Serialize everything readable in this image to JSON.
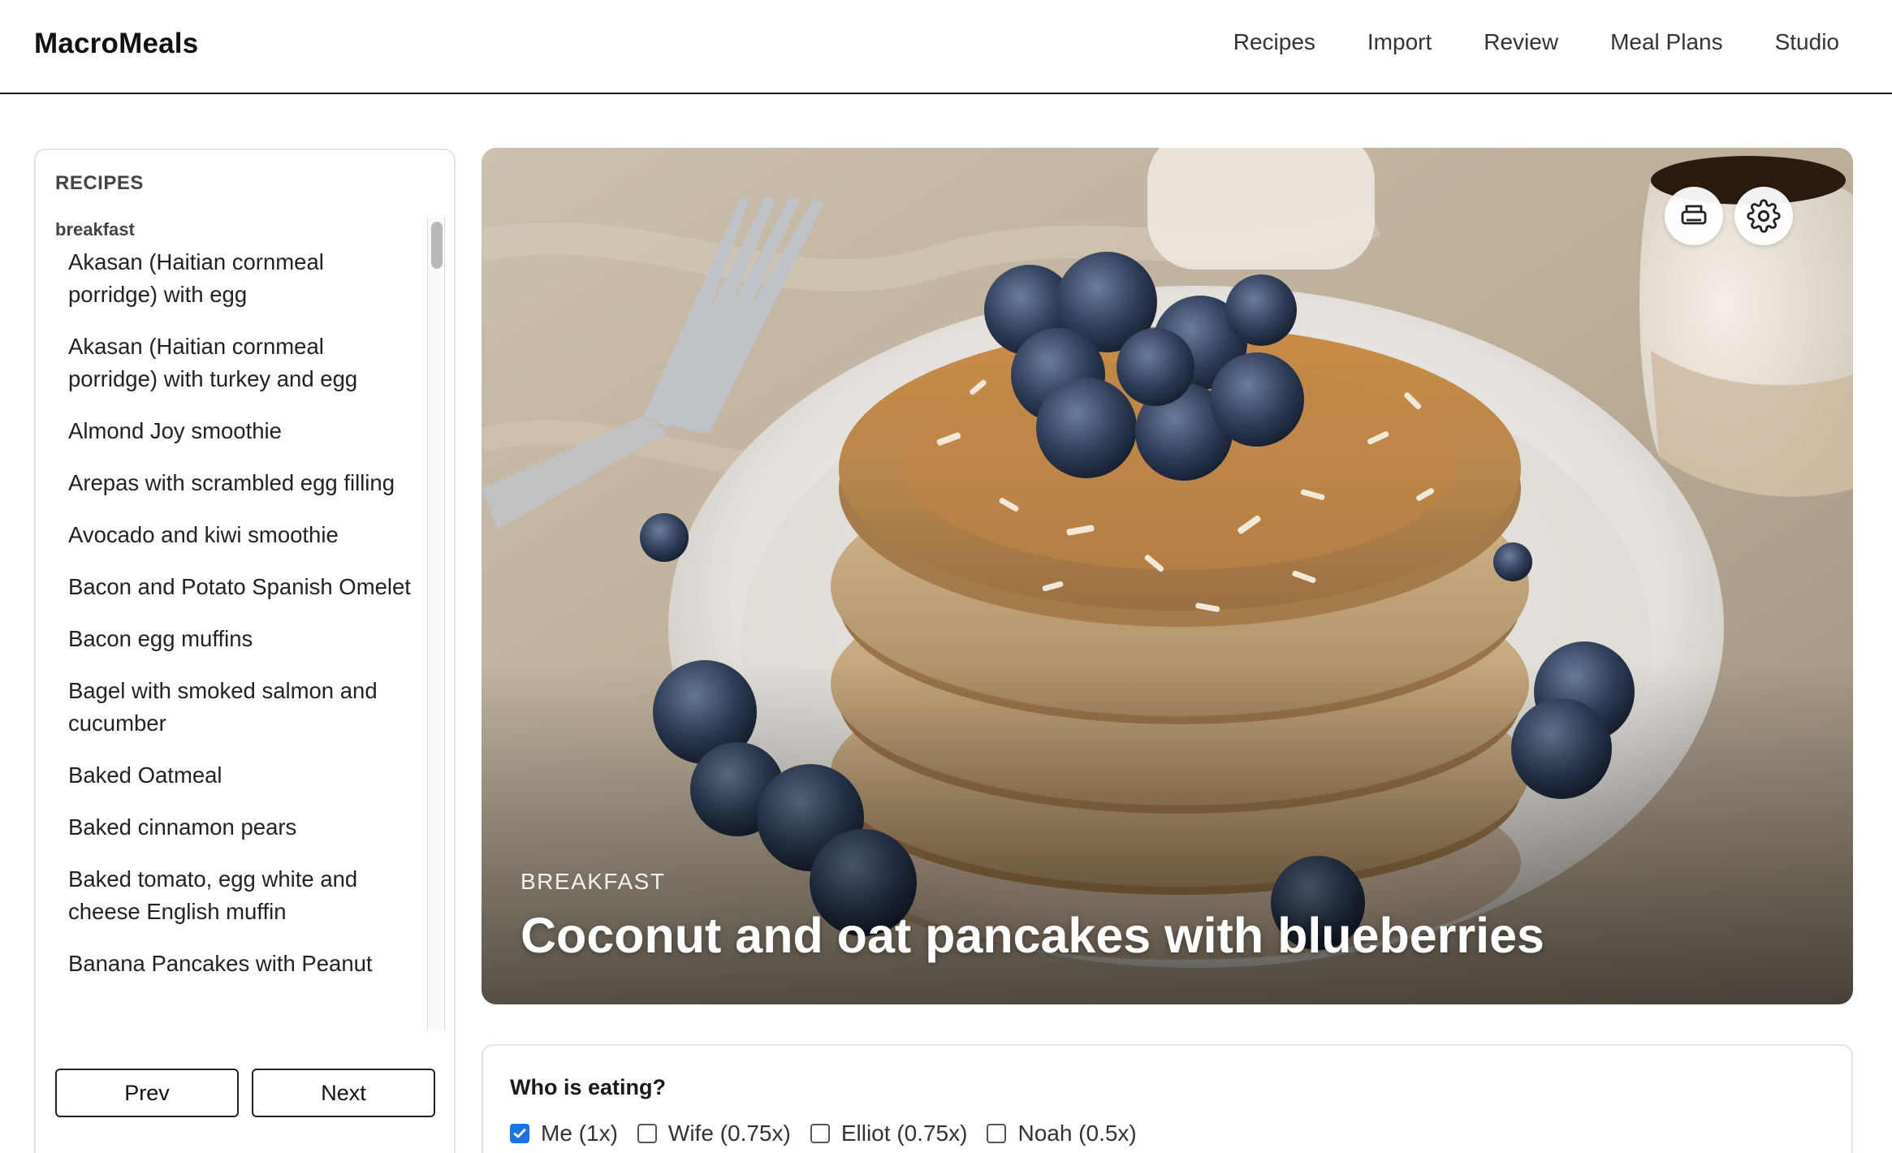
{
  "app": {
    "name": "MacroMeals"
  },
  "nav": {
    "items": [
      "Recipes",
      "Import",
      "Review",
      "Meal Plans",
      "Studio"
    ]
  },
  "sidebar": {
    "heading": "RECIPES",
    "group": "breakfast",
    "items": [
      "Akasan (Haitian cornmeal porridge) with egg",
      "Akasan (Haitian cornmeal porridge) with turkey and egg",
      "Almond Joy smoothie",
      "Arepas with scrambled egg filling",
      "Avocado and kiwi smoothie",
      "Bacon and Potato Spanish Omelet",
      "Bacon egg muffins",
      "Bagel with smoked salmon and cucumber",
      "Baked Oatmeal",
      "Baked cinnamon pears",
      "Baked tomato, egg white and cheese English muffin",
      "Banana Pancakes with Peanut"
    ],
    "prev_label": "Prev",
    "next_label": "Next"
  },
  "hero": {
    "category": "BREAKFAST",
    "title": "Coconut and oat pancakes with blueberries",
    "print_icon": "print-icon",
    "settings_icon": "gear-icon"
  },
  "eaters": {
    "title": "Who is eating?",
    "options": [
      {
        "label": "Me (1x)",
        "checked": true
      },
      {
        "label": "Wife (0.75x)",
        "checked": false
      },
      {
        "label": "Elliot (0.75x)",
        "checked": false
      },
      {
        "label": "Noah (0.5x)",
        "checked": false
      }
    ]
  },
  "colors": {
    "accent": "#1a73e8",
    "header_rule": "#1a1a1a"
  }
}
